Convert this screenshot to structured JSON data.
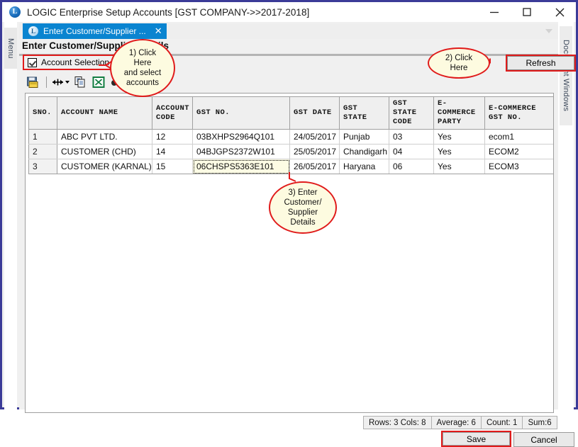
{
  "window": {
    "app_icon": "L",
    "title": "LOGIC Enterprise Setup Accounts  [GST COMPANY->>2017-2018]",
    "minimize_label": "Minimize",
    "maximize_label": "Maximize",
    "close_label": "Close"
  },
  "left_panel": {
    "label": "Menu"
  },
  "right_panel": {
    "label": "Document Windows"
  },
  "tab_bar": {
    "tab_icon": "L",
    "tab_label": "Enter Customer/Supplier ...",
    "tab_close": "✕",
    "overflow_label": "More windows"
  },
  "form": {
    "title": "Enter Customer/Supplier Details",
    "account_selection_label": "Account Selection",
    "account_selection_checked": true,
    "refresh_label": "Refresh"
  },
  "toolbar": {
    "icons": [
      {
        "name": "save-to-disk-icon",
        "title": "Save"
      },
      {
        "name": "resize-columns-icon",
        "title": "Fit columns"
      },
      {
        "name": "copy-icon",
        "title": "Copy"
      },
      {
        "name": "export-excel-icon",
        "title": "Export to Excel"
      },
      {
        "name": "find-icon",
        "title": "Find"
      }
    ]
  },
  "grid": {
    "columns": [
      "SNO.",
      "ACCOUNT NAME",
      "ACCOUNT CODE",
      "GST NO.",
      "GST DATE",
      "GST STATE",
      "GST STATE CODE",
      "E-COMMERCE PARTY",
      "E-COMMERCE GST NO."
    ],
    "rows": [
      {
        "sno": "1",
        "account_name": "ABC PVT LTD.",
        "account_code": "12",
        "gst_no": "03BXHPS2964Q101",
        "gst_date": "24/05/2017",
        "gst_state": "Punjab",
        "gst_state_code": "03",
        "ecommerce_party": "Yes",
        "ecommerce_gst_no": "ecom1"
      },
      {
        "sno": "2",
        "account_name": "CUSTOMER (CHD)",
        "account_code": "14",
        "gst_no": "04BJGPS2372W101",
        "gst_date": "25/05/2017",
        "gst_state": "Chandigarh",
        "gst_state_code": "04",
        "ecommerce_party": "Yes",
        "ecommerce_gst_no": "ECOM2"
      },
      {
        "sno": "3",
        "account_name": "CUSTOMER (KARNAL)",
        "account_code": "15",
        "gst_no": "06CHSPS5363E101",
        "gst_date": "26/05/2017",
        "gst_state": "Haryana",
        "gst_state_code": "06",
        "ecommerce_party": "Yes",
        "ecommerce_gst_no": "ECOM3"
      }
    ],
    "active_cell": {
      "row": 3,
      "column": "GST NO."
    }
  },
  "status_bar": {
    "rows_cols": "Rows: 3  Cols: 8",
    "average": "Average: 6",
    "count": "Count: 1",
    "sum": "Sum:6"
  },
  "footer": {
    "save_label": "Save",
    "cancel_label": "Cancel"
  },
  "annotations": [
    {
      "id": "1",
      "lines": [
        "1) Click",
        "Here",
        "and select",
        "accounts"
      ]
    },
    {
      "id": "2",
      "lines": [
        "2) Click",
        "Here"
      ]
    },
    {
      "id": "3",
      "lines": [
        "3) Enter",
        "Customer/",
        "Supplier",
        "Details"
      ]
    }
  ],
  "colors": {
    "window_border": "#3b3b98",
    "tab_active": "#0a84d0",
    "annotation_red": "#e01b1b",
    "annotation_fill": "#fdfbe0",
    "header_bg": "#efefef"
  }
}
